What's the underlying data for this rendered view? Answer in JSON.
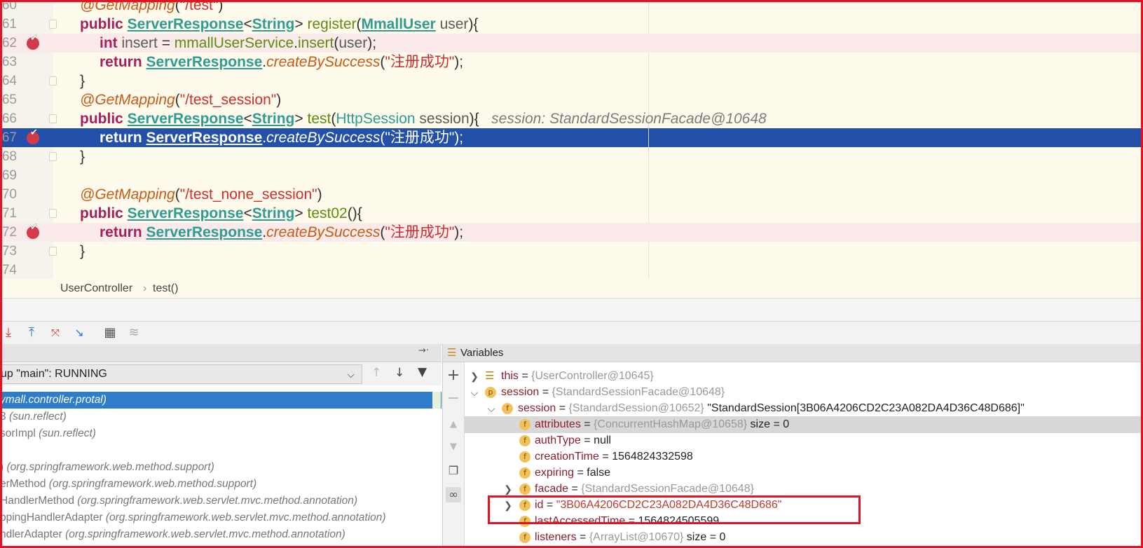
{
  "editor": {
    "lines": [
      {
        "num": "60",
        "tokens": [
          [
            "ann",
            "@GetMapping"
          ],
          [
            "plain",
            "(\""
          ],
          [
            "str",
            "/test"
          ],
          [
            "plain",
            "\")"
          ]
        ]
      },
      {
        "num": "61",
        "tokens": [
          [
            "kw",
            "public "
          ],
          [
            "typ",
            "ServerResponse"
          ],
          [
            "plain",
            "<"
          ],
          [
            "typ",
            "String"
          ],
          [
            "plain",
            "> "
          ],
          [
            "mth",
            "register"
          ],
          [
            "plain",
            "("
          ],
          [
            "typ",
            "MmallUser"
          ],
          [
            "plain",
            " "
          ],
          [
            "var",
            "user"
          ],
          [
            "plain",
            "){"
          ]
        ]
      },
      {
        "num": "62",
        "tokens": [
          [
            "kw",
            "int "
          ],
          [
            "var",
            "insert"
          ],
          [
            "plain",
            " = "
          ],
          [
            "mth",
            "mmallUserService"
          ],
          [
            "plain",
            "."
          ],
          [
            "mth",
            "insert"
          ],
          [
            "plain",
            "("
          ],
          [
            "var",
            "user"
          ],
          [
            "plain",
            ");"
          ]
        ]
      },
      {
        "num": "63",
        "tokens": [
          [
            "kw",
            "return "
          ],
          [
            "typ",
            "ServerResponse"
          ],
          [
            "plain",
            "."
          ],
          [
            "smth",
            "createBySuccess"
          ],
          [
            "plain",
            "("
          ],
          [
            "str",
            "\"注册成功\""
          ],
          [
            "plain",
            ");"
          ]
        ]
      },
      {
        "num": "64",
        "tokens": [
          [
            "plain",
            "}"
          ]
        ]
      },
      {
        "num": "65",
        "tokens": [
          [
            "ann",
            "@GetMapping"
          ],
          [
            "plain",
            "("
          ],
          [
            "str",
            "\"/test_session\""
          ],
          [
            "plain",
            ")"
          ]
        ]
      },
      {
        "num": "66",
        "tokens": [
          [
            "kw",
            "public "
          ],
          [
            "typ",
            "ServerResponse"
          ],
          [
            "plain",
            "<"
          ],
          [
            "typ",
            "String"
          ],
          [
            "plain",
            "> "
          ],
          [
            "mth",
            "test"
          ],
          [
            "plain",
            "("
          ],
          [
            "cls",
            "HttpSession"
          ],
          [
            "plain",
            " "
          ],
          [
            "var",
            "session"
          ],
          [
            "plain",
            "){"
          ],
          [
            "inl",
            "   session: StandardSessionFacade@10648"
          ]
        ]
      },
      {
        "num": "67",
        "tokens": [
          [
            "kw",
            "return "
          ],
          [
            "typ",
            "ServerResponse"
          ],
          [
            "plain",
            "."
          ],
          [
            "smth",
            "createBySuccess"
          ],
          [
            "plain",
            "("
          ],
          [
            "str",
            "\"注册成功\""
          ],
          [
            "plain",
            ");"
          ]
        ]
      },
      {
        "num": "68",
        "tokens": [
          [
            "plain",
            "}"
          ]
        ]
      },
      {
        "num": "69",
        "tokens": []
      },
      {
        "num": "70",
        "tokens": [
          [
            "ann",
            "@GetMapping"
          ],
          [
            "plain",
            "("
          ],
          [
            "str",
            "\"/test_none_session\""
          ],
          [
            "plain",
            ")"
          ]
        ]
      },
      {
        "num": "71",
        "tokens": [
          [
            "kw",
            "public "
          ],
          [
            "typ",
            "ServerResponse"
          ],
          [
            "plain",
            "<"
          ],
          [
            "typ",
            "String"
          ],
          [
            "plain",
            "> "
          ],
          [
            "mth",
            "test02"
          ],
          [
            "plain",
            "(){"
          ]
        ]
      },
      {
        "num": "72",
        "tokens": [
          [
            "kw",
            "return "
          ],
          [
            "typ",
            "ServerResponse"
          ],
          [
            "plain",
            "."
          ],
          [
            "smth",
            "createBySuccess"
          ],
          [
            "plain",
            "("
          ],
          [
            "str",
            "\"注册成功\""
          ],
          [
            "plain",
            ");"
          ]
        ]
      },
      {
        "num": "73",
        "tokens": [
          [
            "plain",
            "}"
          ]
        ]
      },
      {
        "num": "74",
        "tokens": []
      }
    ]
  },
  "breadcrumb": {
    "class_name": "UserController",
    "separator": "›",
    "method": "test()"
  },
  "debugger": {
    "toolbar_icons": [
      "step-out-red-icon",
      "step-out-icon",
      "drop-frame-icon",
      "run-to-cursor-icon",
      "evaluate-table-icon",
      "trace-icon"
    ],
    "thread_select": "up \"main\": RUNNING",
    "frames": [
      {
        "method": "",
        "package": "ymall.controller.protal)"
      },
      {
        "method": "3 ",
        "package": "(sun.reflect)"
      },
      {
        "method": "sorImpl ",
        "package": "(sun.reflect)"
      },
      {
        "method": "",
        "package": ""
      },
      {
        "method": ") ",
        "package": "(org.springframework.web.method.support)"
      },
      {
        "method": "erMethod ",
        "package": "(org.springframework.web.method.support)"
      },
      {
        "method": "HandlerMethod ",
        "package": "(org.springframework.web.servlet.mvc.method.annotation)"
      },
      {
        "method": "ppingHandlerAdapter ",
        "package": "(org.springframework.web.servlet.mvc.method.annotation)"
      },
      {
        "method": "ndlerAdapter ",
        "package": "(org.springframework.web.servlet.mvc.method.annotation)"
      }
    ],
    "variables_title": "Variables",
    "variables": [
      {
        "name": "this",
        "eq": " = ",
        "ref": "{UserController@10645}",
        "value": ""
      },
      {
        "name": "session",
        "eq": " = ",
        "ref": "{StandardSessionFacade@10648}",
        "value": ""
      },
      {
        "name": "session",
        "eq": " = ",
        "ref": "{StandardSession@10652}",
        "value": " \"StandardSession[3B06A4206CD2C23A082DA4D36C48D686]\""
      },
      {
        "name": "attributes",
        "eq": " = ",
        "ref": "{ConcurrentHashMap@10658}",
        "value": "  size = 0"
      },
      {
        "name": "authType",
        "eq": " = ",
        "ref": "",
        "value": "null"
      },
      {
        "name": "creationTime",
        "eq": " = ",
        "ref": "",
        "value": "1564824332598"
      },
      {
        "name": "expiring",
        "eq": " = ",
        "ref": "",
        "value": "false"
      },
      {
        "name": "facade",
        "eq": " = ",
        "ref": "{StandardSessionFacade@10648}",
        "value": ""
      },
      {
        "name": "id",
        "eq": " = ",
        "ref": "",
        "value": "\"3B06A4206CD2C23A082DA4D36C48D686\""
      },
      {
        "name": "lastAccessedTime",
        "eq": " = ",
        "ref": "",
        "value": "1564824505599"
      },
      {
        "name": "listeners",
        "eq": " = ",
        "ref": "{ArrayList@10670}",
        "value": "  size = 0"
      }
    ]
  },
  "colors": {
    "highlight_box": "#e81123",
    "current_line": "#2350a8",
    "selected_frame": "#2e7dcb"
  }
}
